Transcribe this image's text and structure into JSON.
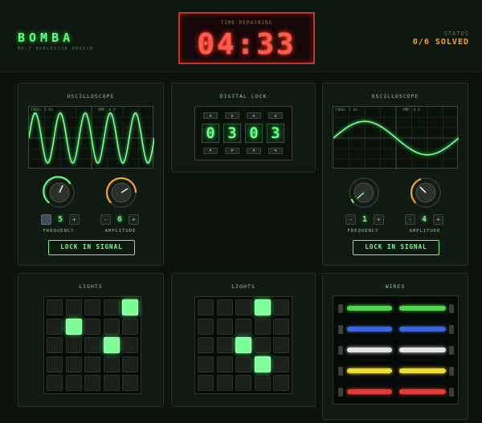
{
  "header": {
    "brand": "BOMBA",
    "subtitle": "MK-7 EXPLOSIVE DEVICE",
    "timer_label": "TIME REMAINING",
    "timer_value": "04:33",
    "status_label": "STATUS",
    "status_value": "0/6 SOLVED"
  },
  "osc_left": {
    "title": "OSCILLOSCOPE",
    "freq_tag": "FREQ: 5 Hz",
    "amp_tag": "AMP: 6 V",
    "frequency": "5",
    "amplitude": "6",
    "frequency_label": "FREQUENCY",
    "amplitude_label": "AMPLITUDE",
    "lock_label": "LOCK IN SIGNAL"
  },
  "osc_right": {
    "title": "OSCILLOSCOPE",
    "freq_tag": "FREQ: 1 Hz",
    "amp_tag": "AMP: 4 V",
    "frequency": "1",
    "amplitude": "4",
    "frequency_label": "FREQUENCY",
    "amplitude_label": "AMPLITUDE",
    "lock_label": "LOCK IN SIGNAL"
  },
  "lock": {
    "title": "DIGITAL LOCK",
    "digits": [
      "0",
      "3",
      "0",
      "3"
    ],
    "up": "▲",
    "down": "▼"
  },
  "lights_left": {
    "title": "LIGHTS",
    "on": [
      [
        0,
        4
      ],
      [
        1,
        1
      ],
      [
        2,
        3
      ]
    ]
  },
  "lights_mid": {
    "title": "LIGHTS",
    "on": [
      [
        0,
        3
      ],
      [
        2,
        2
      ],
      [
        3,
        3
      ]
    ]
  },
  "wires": {
    "title": "WIRES",
    "colors": [
      "#4fd64a",
      "#3a66e0",
      "#e6e6e6",
      "#f0dc2a",
      "#e23a34"
    ]
  },
  "controls": {
    "minus": "-",
    "plus": "+"
  }
}
